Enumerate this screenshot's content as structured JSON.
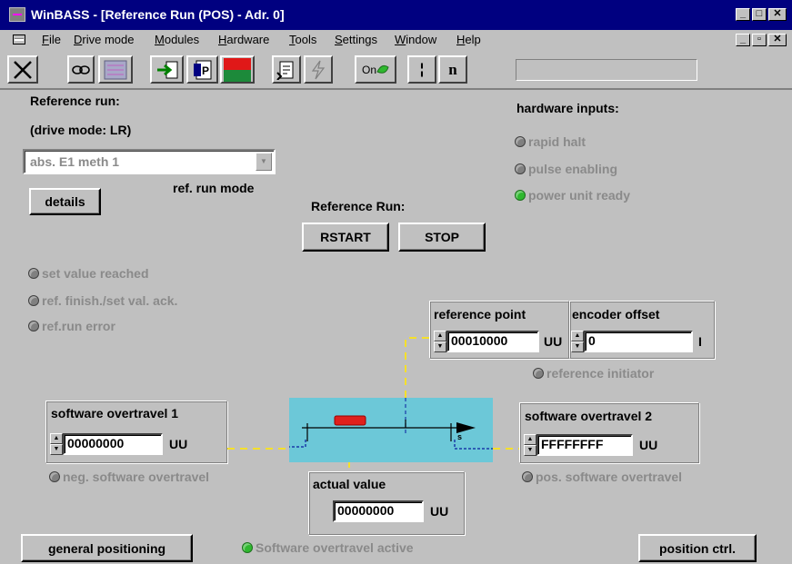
{
  "window": {
    "title": "WinBASS - [Reference Run (POS) - Adr. 0]"
  },
  "menu": [
    "File",
    "Drive mode",
    "Modules",
    "Hardware",
    "Tools",
    "Settings",
    "Window",
    "Help"
  ],
  "toolbar": {
    "on_label": "On",
    "n_label": "n",
    "pause_label": "¦"
  },
  "reference_run": {
    "heading": "Reference run:",
    "drive_mode": "(drive mode: LR)",
    "mode_select_value": "abs. E1 meth 1",
    "mode_label": "ref. run mode",
    "details_button": "details",
    "run_heading": "Reference Run:",
    "start_button": "RSTART",
    "stop_button": "STOP"
  },
  "hardware_inputs": {
    "heading": "hardware inputs:",
    "items": [
      {
        "label": "rapid halt",
        "active": false
      },
      {
        "label": "pulse enabling",
        "active": false
      },
      {
        "label": "power unit ready",
        "active": true
      }
    ]
  },
  "status_signals": [
    {
      "label": "set value reached",
      "active": false
    },
    {
      "label": "ref. finish./set val. ack.",
      "active": false
    },
    {
      "label": "ref.run error",
      "active": false
    }
  ],
  "reference_point": {
    "label": "reference point",
    "value": "00010000",
    "unit": "UU"
  },
  "encoder_offset": {
    "label": "encoder offset",
    "value": "0",
    "unit": "I"
  },
  "reference_initiator": {
    "label": "reference initiator",
    "active": false
  },
  "software_overtravel_1": {
    "label": "software overtravel 1",
    "value": "00000000",
    "unit": "UU",
    "status_label": "neg. software overtravel"
  },
  "software_overtravel_2": {
    "label": "software overtravel 2",
    "value": "FFFFFFFF",
    "unit": "UU",
    "status_label": "pos. software overtravel"
  },
  "actual_value": {
    "label": "actual value",
    "value": "00000000",
    "unit": "UU"
  },
  "axis": {
    "end_marker": "s"
  },
  "footer": {
    "general_positioning_button": "general positioning",
    "overtravel_active_label": "Software overtravel active",
    "position_ctrl_button": "position ctrl."
  },
  "colors": {
    "title_bar": "#000080",
    "axis_background": "#6cc8d8",
    "carriage": "#e0201c",
    "led_active": "#2fb82f",
    "led_inactive": "#808080",
    "guide_line": "#f5e02a",
    "axis_mark": "#1a3aa8"
  }
}
